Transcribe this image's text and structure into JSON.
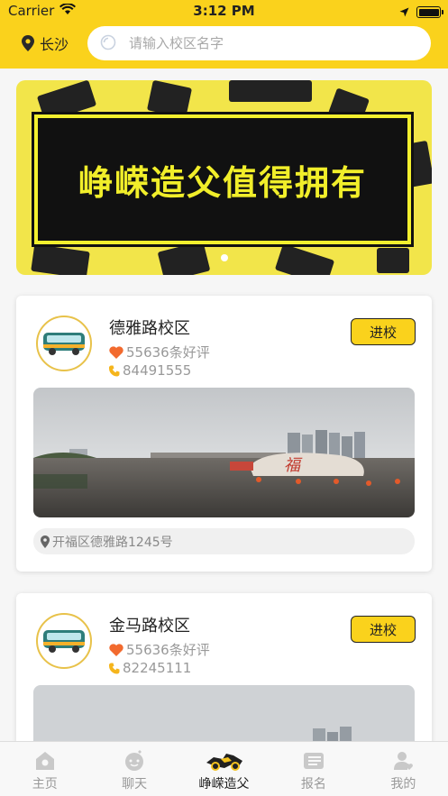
{
  "status_bar": {
    "carrier": "Carrier",
    "time": "3:12 PM",
    "battery_level": 1.0
  },
  "header": {
    "city": "长沙",
    "search_placeholder": "请输入校区名字"
  },
  "banner": {
    "slogan": "峥嵘造父值得拥有",
    "page_count": 1,
    "active_page": 1
  },
  "schools": [
    {
      "name": "德雅路校区",
      "rating": "55636条好评",
      "phone": "84491555",
      "button": "进校",
      "address": "开福区德雅路1245号"
    },
    {
      "name": "金马路校区",
      "rating": "55636条好评",
      "phone": "82245111",
      "button": "进校",
      "address": ""
    }
  ],
  "tabs": [
    {
      "label": "主页",
      "icon": "home-icon"
    },
    {
      "label": "聊天",
      "icon": "chat-icon"
    },
    {
      "label": "峥嵘造父",
      "icon": "brand-logo-icon"
    },
    {
      "label": "报名",
      "icon": "signup-icon"
    },
    {
      "label": "我的",
      "icon": "profile-icon"
    }
  ],
  "colors": {
    "accent": "#fad21c",
    "heart": "#f26a2e",
    "phone_icon": "#f5b51c",
    "banner_bg": "#f2e54a"
  }
}
